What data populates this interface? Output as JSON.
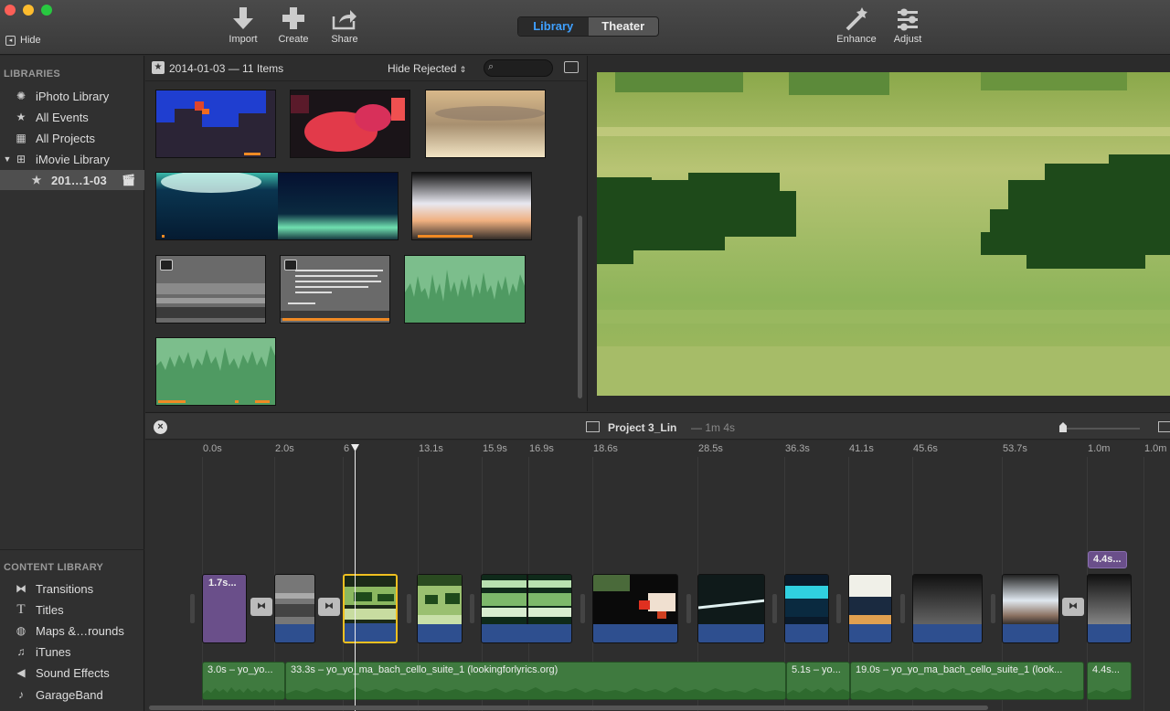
{
  "toolbar": {
    "hide_label": "Hide",
    "import_label": "Import",
    "create_label": "Create",
    "share_label": "Share",
    "library_label": "Library",
    "theater_label": "Theater",
    "enhance_label": "Enhance",
    "adjust_label": "Adjust"
  },
  "sidebar": {
    "libraries_heading": "LIBRARIES",
    "libraries": [
      {
        "label": "iPhoto Library",
        "icon": "iphoto-icon"
      },
      {
        "label": "All Events",
        "icon": "star-icon"
      },
      {
        "label": "All Projects",
        "icon": "clapper-icon"
      },
      {
        "label": "iMovie Library",
        "icon": "grid-icon"
      },
      {
        "label": "201…1-03",
        "icon": "star-icon"
      }
    ],
    "content_heading": "CONTENT LIBRARY",
    "content": [
      {
        "label": "Transitions",
        "icon": "transitions-icon"
      },
      {
        "label": "Titles",
        "icon": "titles-icon"
      },
      {
        "label": "Maps &…rounds",
        "icon": "globe-icon"
      },
      {
        "label": "iTunes",
        "icon": "music-note-icon"
      },
      {
        "label": "Sound Effects",
        "icon": "speaker-icon"
      },
      {
        "label": "GarageBand",
        "icon": "guitar-icon"
      }
    ]
  },
  "browser": {
    "event_title": "2014-01-03 — 11 Items",
    "filter_label": "Hide Rejected"
  },
  "timeline": {
    "project_name": "Project 3_Lin",
    "project_duration": "— 1m 4s",
    "ticks": [
      "0.0s",
      "2.0s",
      "6",
      "13.1s",
      "15.9s",
      "16.9s",
      "18.6s",
      "28.5s",
      "36.3s",
      "41.1s",
      "45.6s",
      "53.7s",
      "1.0m",
      "1.0m"
    ],
    "first_clip_title": "1.7s...",
    "last_clip_badge": "4.4s...",
    "music": [
      "3.0s – yo_yo...",
      "33.3s – yo_yo_ma_bach_cello_suite_1 (lookingforlyrics.org)",
      "5.1s – yo...",
      "19.0s – yo_yo_ma_bach_cello_suite_1 (look...",
      "4.4s..."
    ]
  },
  "colors": {
    "accent": "#3fa0ff",
    "selection": "#f0c020",
    "audio_clip": "#3f7a3f",
    "title_clip": "#6a4f8a",
    "clip_audio_strip": "#2e4f8f",
    "thumb_marker": "#f08a24"
  }
}
